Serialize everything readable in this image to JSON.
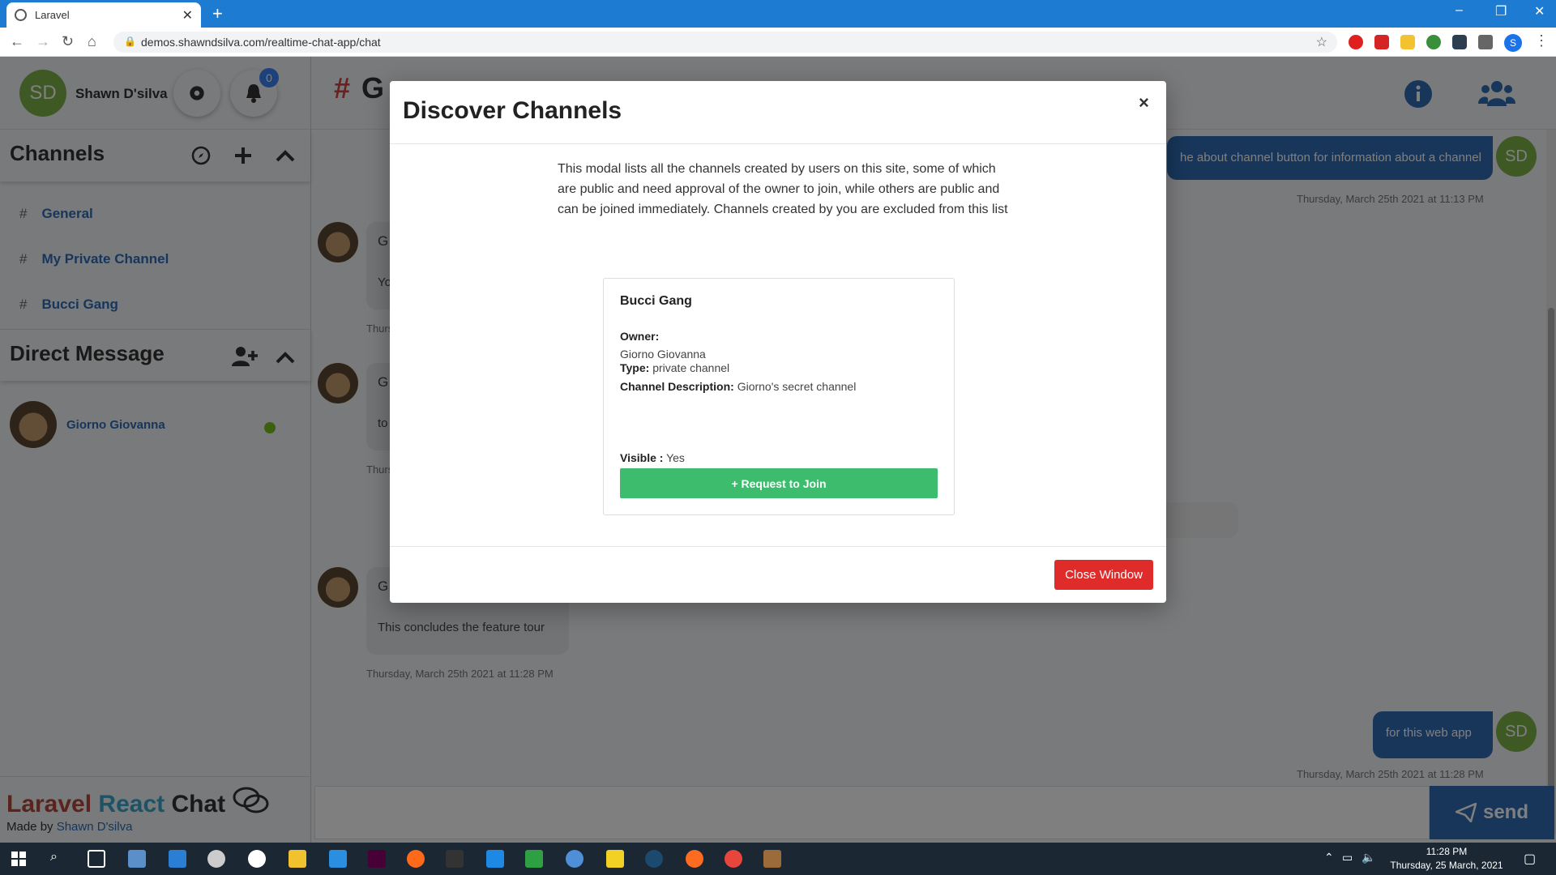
{
  "browser": {
    "tab_title": "Laravel",
    "url": "demos.shawndsilva.com/realtime-chat-app/chat",
    "profile_initial": "S"
  },
  "sidebar": {
    "user_initials": "SD",
    "user_name": "Shawn D'silva",
    "notification_count": "0",
    "channels_title": "Channels",
    "channels": [
      {
        "hash": "#",
        "label": "General"
      },
      {
        "hash": "#",
        "label": "My Private Channel"
      },
      {
        "hash": "#",
        "label": "Bucci Gang"
      }
    ],
    "dm_title": "Direct Message",
    "dms": [
      {
        "name": "Giorno Giovanna"
      }
    ],
    "brand": {
      "part1": "Laravel ",
      "part2": "React ",
      "part3": "Chat"
    },
    "made_by_prefix": "Made by ",
    "made_by_name": "Shawn D'silva"
  },
  "main": {
    "title_hash": "#",
    "title": "G",
    "messages": {
      "out1_text": "he about channel button for information about a channel",
      "out1_time": "Thursday, March 25th 2021 at 11:13 PM",
      "in_g1": "G",
      "in_g1_text": "Yo",
      "in_ts_stub": "Thurs",
      "in_g2": "G",
      "in_g2_text": "to",
      "in_g3": "G",
      "in_g3_text": "This concludes the feature tour",
      "in_g3_time": "Thursday, March 25th 2021 at 11:28 PM",
      "out2_text": "for this web app",
      "out2_time": "Thursday, March 25th 2021 at 11:28 PM",
      "out_initials": "SD"
    },
    "send_label": "send"
  },
  "modal": {
    "title": "Discover Channels",
    "close_glyph": "×",
    "description": "This modal lists all the channels created by users on this site, some of which are public and need approval of the owner to join, while others are public and can be joined immediately. Channels created by you are excluded from this list",
    "card": {
      "name": "Bucci Gang",
      "owner_label": "Owner:",
      "owner_value": "Giorno Giovanna",
      "type_label": "Type:",
      "type_value": "private channel",
      "desc_label": "Channel Description:",
      "desc_value": "Giorno's secret channel",
      "visible_label": "Visible :",
      "visible_value": "Yes",
      "join_label": "+ Request to Join"
    },
    "close_window_label": "Close Window"
  },
  "taskbar": {
    "time": "11:28 PM",
    "date": "Thursday, 25 March, 2021"
  },
  "colors": {
    "chrome_blue": "#1e7bd2",
    "link_blue": "#2f6db5",
    "join_green": "#3cbc6c",
    "close_red": "#e02b2b",
    "online_green": "#7ac121"
  }
}
